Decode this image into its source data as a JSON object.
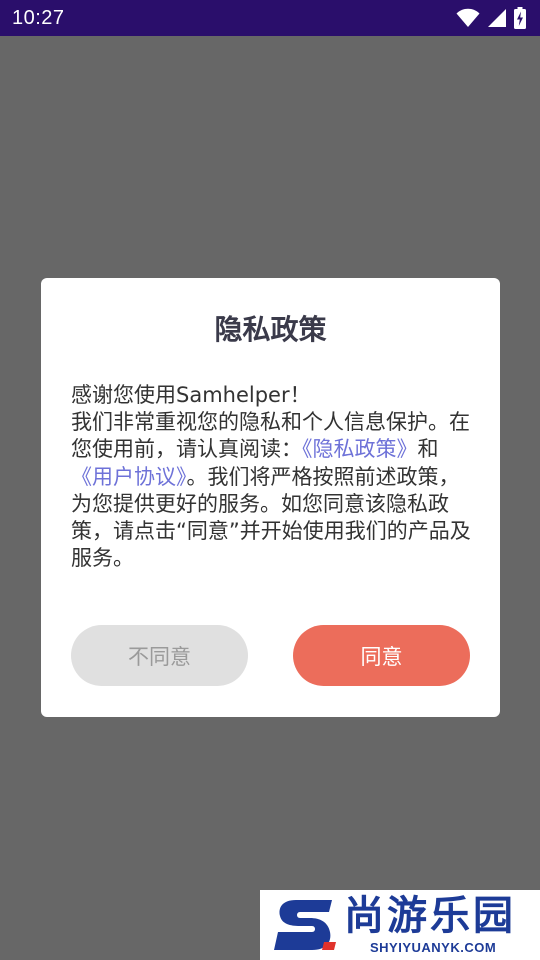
{
  "status_bar": {
    "time": "10:27",
    "icons": [
      "wifi-icon",
      "signal-icon",
      "battery-charging-icon"
    ]
  },
  "dialog": {
    "title": "隐私政策",
    "body": {
      "greeting": "感谢您使用Samhelper！",
      "para_before_links": "我们非常重视您的隐私和个人信息保护。在您使用前，请认真阅读：",
      "privacy_link": "《隐私政策》",
      "and_word": "和",
      "user_agreement_link": "《用户协议》",
      "para_after_links": "。我们将严格按照前述政策，为您提供更好的服务。如您同意该隐私政策，请点击“同意”并开始使用我们的产品及服务。"
    },
    "disagree_button": "不同意",
    "agree_button": "同意"
  },
  "watermark": {
    "name": "尚游乐园",
    "url": "SHYIYUANYK.COM"
  },
  "colors": {
    "status_bar": "#2a0e6b",
    "scrim": "#676767",
    "link": "#6e72d8",
    "agree": "#ec6d5b",
    "disagree": "#e0e0e0",
    "watermark": "#1d3b97"
  }
}
